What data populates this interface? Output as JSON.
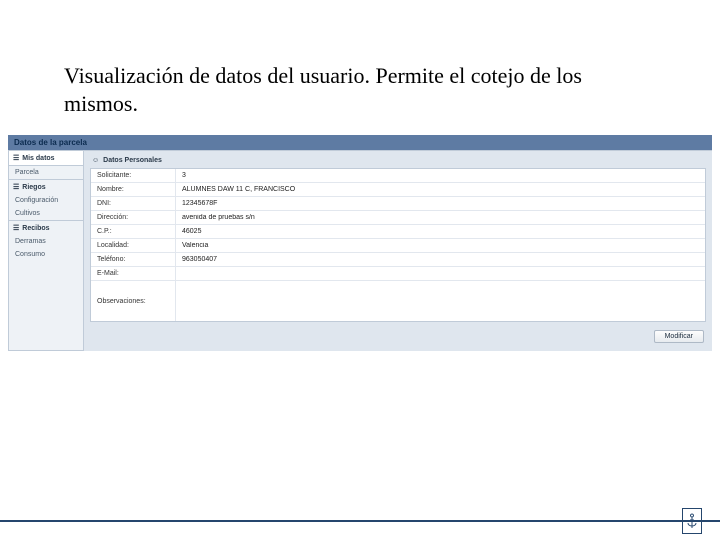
{
  "slide": {
    "title": "Visualización de datos del usuario. Permite el cotejo de los mismos."
  },
  "app": {
    "header": "Datos de la parcela",
    "sidebar": {
      "misDatos": {
        "label": "Mis datos",
        "sub": "Parcela"
      },
      "riegos": {
        "label": "Riegos",
        "items": [
          "Configuración",
          "Cultivos"
        ]
      },
      "recibos": {
        "label": "Recibos",
        "items": [
          "Derramas",
          "Consumo"
        ]
      }
    },
    "panel": {
      "title": "Datos Personales",
      "fields": {
        "solicitante": {
          "label": "Solicitante:",
          "value": "3"
        },
        "nombre": {
          "label": "Nombre:",
          "value": "ALUMNES DAW 11 C, FRANCISCO"
        },
        "dni": {
          "label": "DNI:",
          "value": "12345678F"
        },
        "direccion": {
          "label": "Dirección:",
          "value": "avenida de pruebas s/n"
        },
        "cp": {
          "label": "C.P.:",
          "value": "46025"
        },
        "localidad": {
          "label": "Localidad:",
          "value": "Valencia"
        },
        "telefono": {
          "label": "Teléfono:",
          "value": "963050407"
        },
        "email": {
          "label": "E-Mail:",
          "value": ""
        },
        "observaciones": {
          "label": "Observaciones:",
          "value": ""
        }
      },
      "button": "Modificar"
    }
  }
}
